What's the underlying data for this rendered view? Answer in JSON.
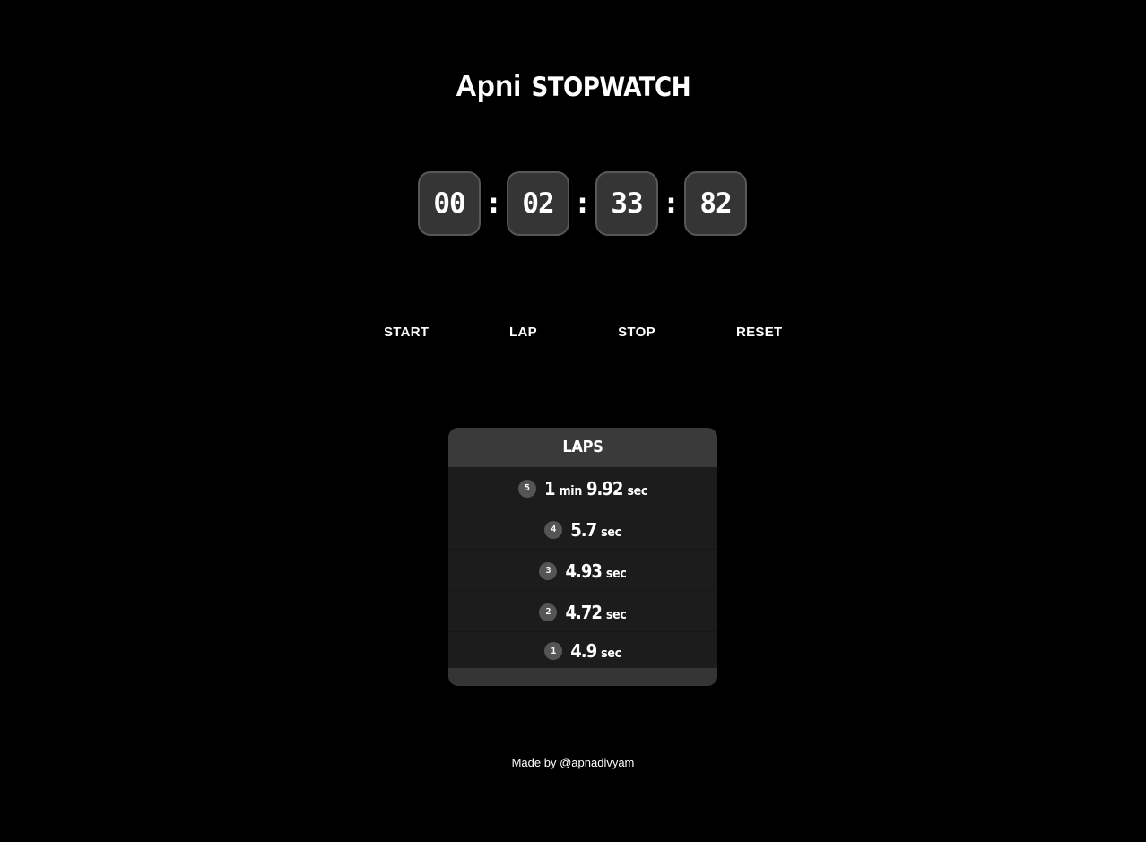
{
  "header": {
    "title_brand": "Apni",
    "title_word": "STOPWATCH"
  },
  "timer": {
    "hours": "00",
    "minutes": "02",
    "seconds": "33",
    "centiseconds": "82",
    "separator": ":"
  },
  "controls": {
    "start_label": "START",
    "lap_label": "LAP",
    "stop_label": "STOP",
    "reset_label": "RESET"
  },
  "laps": {
    "heading": "LAPS",
    "items": [
      {
        "number": "5",
        "minutes": "1",
        "min_unit": "min",
        "seconds": "9.92",
        "sec_unit": "sec"
      },
      {
        "number": "4",
        "minutes": "",
        "min_unit": "",
        "seconds": "5.7",
        "sec_unit": "sec"
      },
      {
        "number": "3",
        "minutes": "",
        "min_unit": "",
        "seconds": "4.93",
        "sec_unit": "sec"
      },
      {
        "number": "2",
        "minutes": "",
        "min_unit": "",
        "seconds": "4.72",
        "sec_unit": "sec"
      },
      {
        "number": "1",
        "minutes": "",
        "min_unit": "",
        "seconds": "4.9",
        "sec_unit": "sec"
      }
    ]
  },
  "footer": {
    "prefix": "Made by",
    "author_link": "@apnadivyam"
  }
}
